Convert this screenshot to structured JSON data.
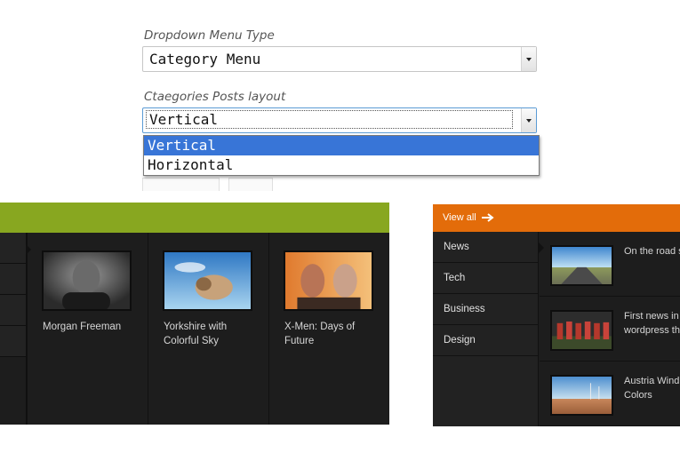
{
  "settings": {
    "dropdown_type": {
      "label": "Dropdown Menu Type",
      "value": "Category Menu"
    },
    "posts_layout": {
      "label": "Ctaegories Posts layout",
      "value": "Vertical",
      "options": [
        "Vertical",
        "Horizontal"
      ]
    }
  },
  "vertical_preview": {
    "accent_color": "#88a720",
    "posts": [
      {
        "title": "Morgan Freeman"
      },
      {
        "title": "Yorkshire with Colorful Sky"
      },
      {
        "title": "X-Men: Days of Future"
      }
    ]
  },
  "horizontal_preview": {
    "accent_color": "#e36c0a",
    "view_all": "View all",
    "categories": [
      "News",
      "Tech",
      "Business",
      "Design"
    ],
    "posts": [
      {
        "title_line1": "On the road s",
        "title_line2": ""
      },
      {
        "title_line1": "First news in",
        "title_line2": "wordpress the"
      },
      {
        "title_line1": "Austria Windr",
        "title_line2": "Colors"
      }
    ]
  }
}
